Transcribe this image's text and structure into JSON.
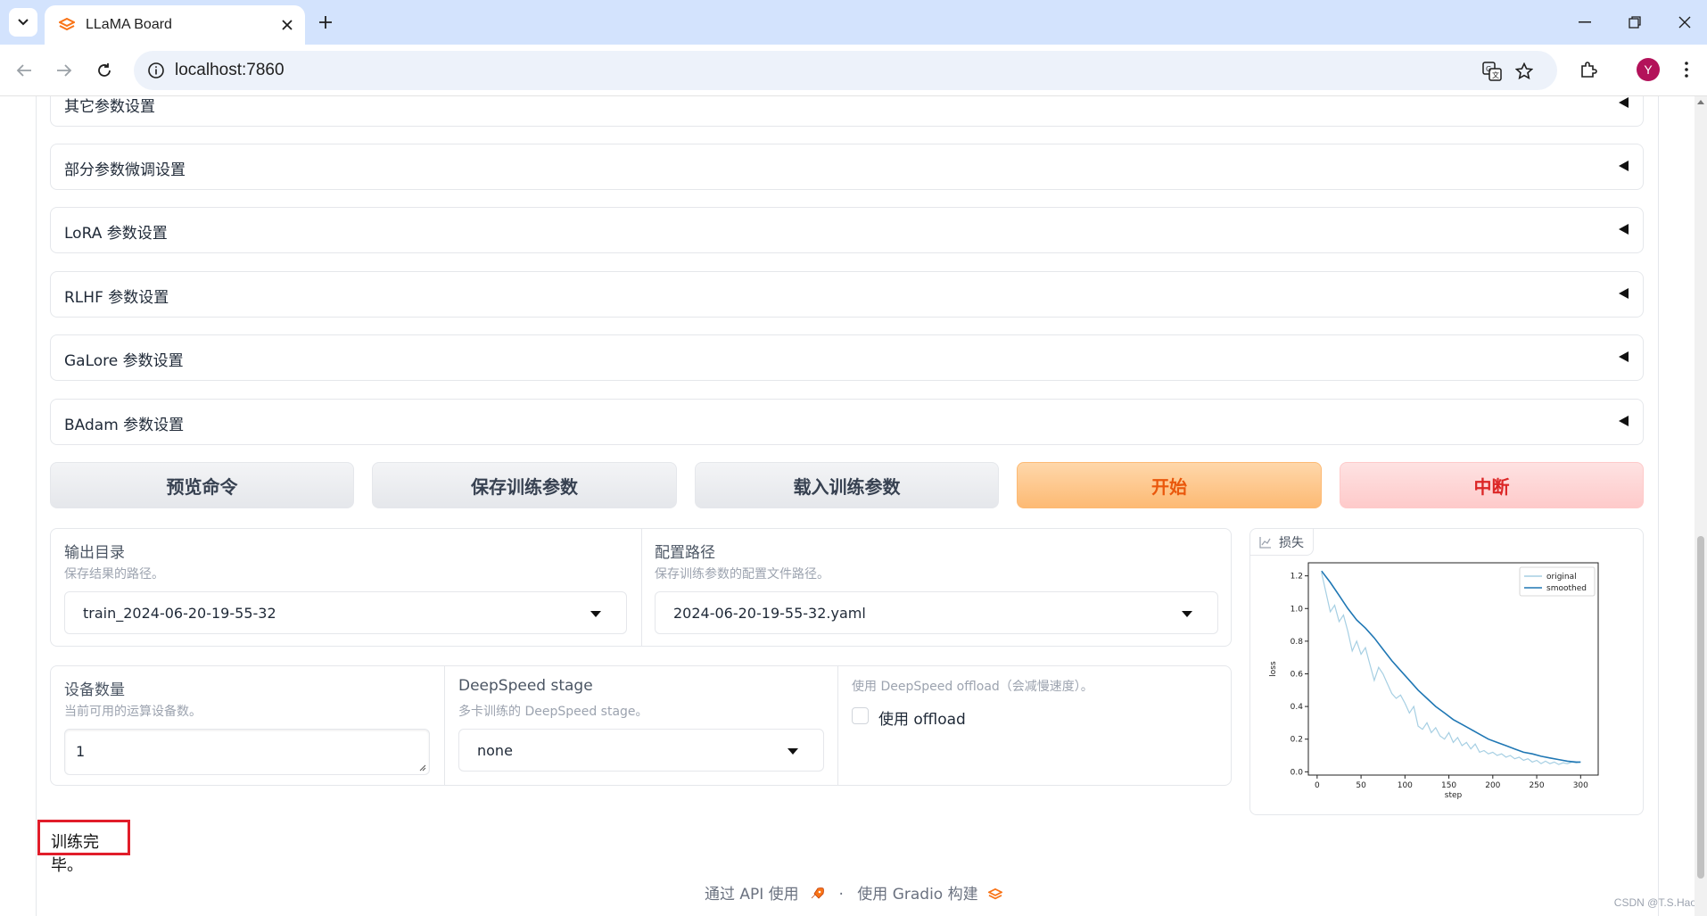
{
  "browser": {
    "tab_title": "LLaMA Board",
    "url": "localhost:7860",
    "avatar_letter": "Y"
  },
  "accordions": [
    {
      "label": "其它参数设置"
    },
    {
      "label": "部分参数微调设置"
    },
    {
      "label": "LoRA 参数设置"
    },
    {
      "label": "RLHF 参数设置"
    },
    {
      "label": "GaLore 参数设置"
    },
    {
      "label": "BAdam 参数设置"
    }
  ],
  "buttons": {
    "preview": "预览命令",
    "save": "保存训练参数",
    "load": "载入训练参数",
    "start": "开始",
    "abort": "中断"
  },
  "output_dir": {
    "label": "输出目录",
    "info": "保存结果的路径。",
    "value": "train_2024-06-20-19-55-32"
  },
  "config_path": {
    "label": "配置路径",
    "info": "保存训练参数的配置文件路径。",
    "value": "2024-06-20-19-55-32.yaml"
  },
  "device_count": {
    "label": "设备数量",
    "info": "当前可用的运算设备数。",
    "value": "1"
  },
  "deepspeed_stage": {
    "label": "DeepSpeed stage",
    "info": "多卡训练的 DeepSpeed stage。",
    "value": "none"
  },
  "deepspeed_offload": {
    "info": "使用 DeepSpeed offload（会减慢速度）。",
    "label": "使用 offload",
    "checked": false
  },
  "loss_plot": {
    "label": "损失"
  },
  "status_text": "训练完毕。",
  "footer": {
    "api_text": "通过 API 使用",
    "separator": "·",
    "built_with": "使用 Gradio 构建"
  },
  "watermark": "CSDN @T.S.Hao",
  "colors": {
    "accent_orange": "#ea580c",
    "stop_red": "#dc2626",
    "original_line": "#a6cfe3",
    "smoothed_line": "#1f77b4"
  },
  "chart_data": {
    "type": "line",
    "title": "",
    "xlabel": "step",
    "ylabel": "loss",
    "xlim": [
      -10,
      320
    ],
    "ylim": [
      -0.02,
      1.28
    ],
    "xticks": [
      0,
      50,
      100,
      150,
      200,
      250,
      300
    ],
    "yticks": [
      0.0,
      0.2,
      0.4,
      0.6,
      0.8,
      1.0,
      1.2
    ],
    "ytick_labels": [
      "0.0",
      "0.2",
      "0.4",
      "0.6",
      "0.8",
      "1.0",
      "1.2"
    ],
    "legend": "top-right",
    "series": [
      {
        "name": "original",
        "x": [
          5,
          10,
          15,
          20,
          25,
          30,
          35,
          40,
          45,
          50,
          55,
          60,
          65,
          70,
          75,
          80,
          85,
          90,
          95,
          100,
          105,
          110,
          115,
          120,
          125,
          130,
          135,
          140,
          145,
          150,
          155,
          160,
          165,
          170,
          175,
          180,
          185,
          190,
          195,
          200,
          205,
          210,
          215,
          220,
          225,
          230,
          235,
          240,
          245,
          250,
          255,
          260,
          265,
          270,
          275,
          280,
          285,
          290,
          295,
          300
        ],
        "y": [
          1.22,
          1.1,
          0.98,
          1.02,
          0.92,
          0.96,
          0.86,
          0.74,
          0.8,
          0.72,
          0.76,
          0.66,
          0.56,
          0.64,
          0.6,
          0.54,
          0.48,
          0.45,
          0.47,
          0.42,
          0.36,
          0.4,
          0.28,
          0.26,
          0.3,
          0.24,
          0.27,
          0.22,
          0.2,
          0.24,
          0.18,
          0.21,
          0.16,
          0.18,
          0.14,
          0.17,
          0.12,
          0.13,
          0.11,
          0.12,
          0.1,
          0.11,
          0.09,
          0.1,
          0.08,
          0.09,
          0.07,
          0.08,
          0.06,
          0.07,
          0.05,
          0.065,
          0.05,
          0.06,
          0.045,
          0.055,
          0.05,
          0.06,
          0.055,
          0.06
        ]
      },
      {
        "name": "smoothed",
        "x": [
          5,
          15,
          25,
          35,
          45,
          55,
          65,
          75,
          85,
          95,
          105,
          115,
          125,
          135,
          145,
          155,
          165,
          175,
          185,
          195,
          205,
          215,
          225,
          235,
          245,
          255,
          265,
          275,
          285,
          295,
          300
        ],
        "y": [
          1.23,
          1.16,
          1.08,
          1.0,
          0.93,
          0.88,
          0.82,
          0.75,
          0.68,
          0.62,
          0.56,
          0.5,
          0.45,
          0.4,
          0.36,
          0.32,
          0.29,
          0.26,
          0.23,
          0.2,
          0.18,
          0.16,
          0.14,
          0.12,
          0.11,
          0.095,
          0.085,
          0.075,
          0.065,
          0.06,
          0.06
        ]
      }
    ]
  }
}
